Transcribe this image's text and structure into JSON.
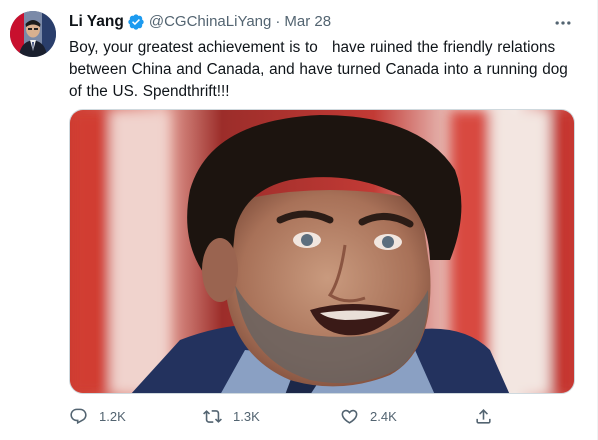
{
  "tweet": {
    "author_name": "Li Yang",
    "handle": "@CGChinaLiYang",
    "separator": "·",
    "date": "Mar 28",
    "text": "Boy, your greatest achievement is to   have ruined the friendly relations between China and Canada, and have turned Canada into a running dog of the US. Spendthrift!!!",
    "verified": true
  },
  "actions": {
    "reply_count": "1.2K",
    "retweet_count": "1.3K",
    "like_count": "2.4K"
  },
  "colors": {
    "accent": "#1d9bf0",
    "text": "#0f1419",
    "secondary": "#536471"
  },
  "icons": {
    "verified": "verified-badge-icon",
    "more": "more-options-icon",
    "reply": "reply-icon",
    "retweet": "retweet-icon",
    "like": "heart-icon",
    "share": "share-icon"
  }
}
